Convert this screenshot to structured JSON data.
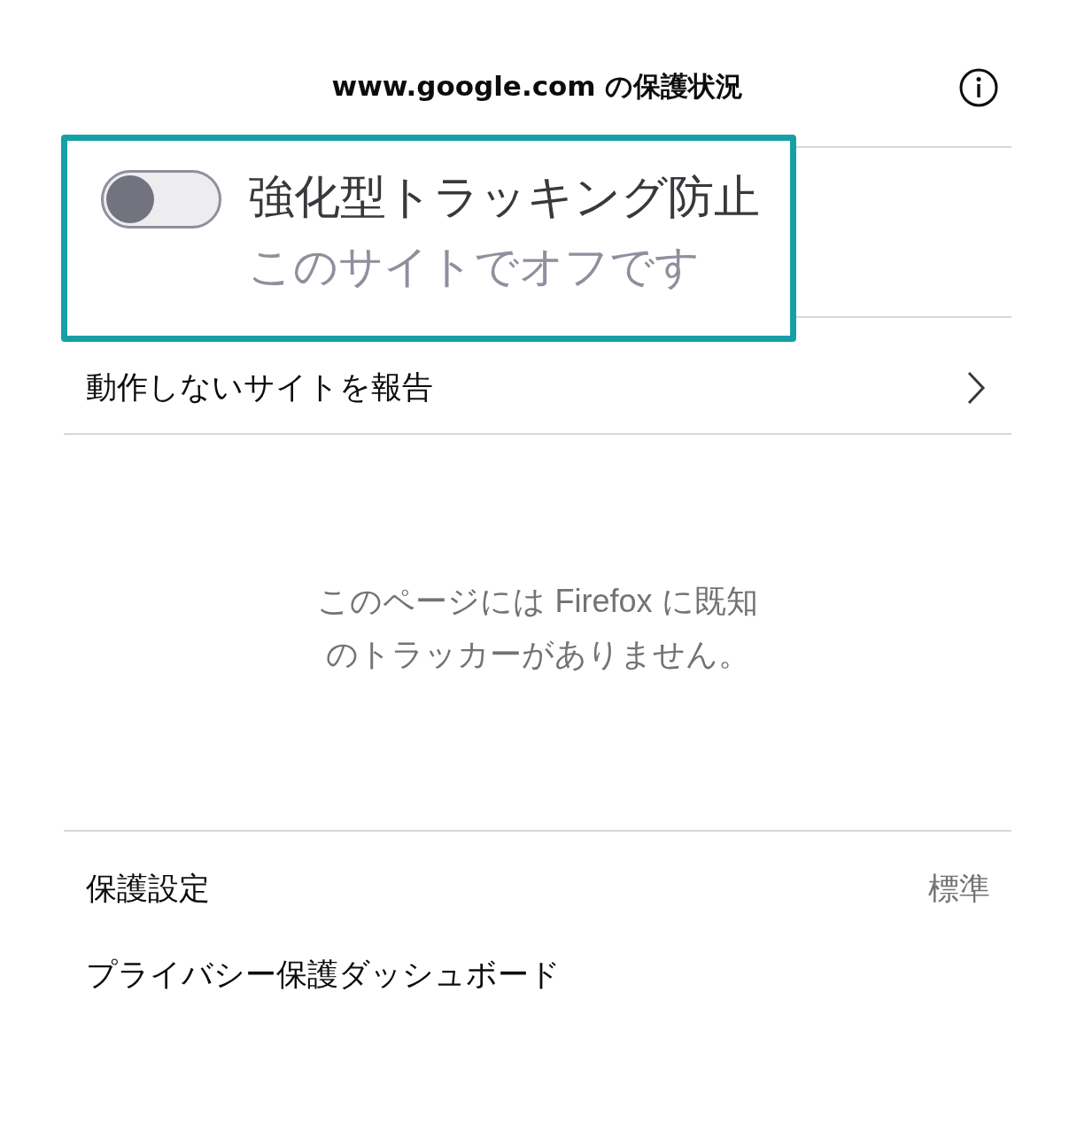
{
  "header": {
    "title": "www.google.com の保護状況"
  },
  "tracking_protection": {
    "label": "強化型トラッキング防止",
    "status": "このサイトでオフです",
    "on": false
  },
  "report_link": {
    "label": "動作しないサイトを報告"
  },
  "message": "このページには Firefox に既知のトラッカーがありません。",
  "settings": {
    "label": "保護設定",
    "value": "標準"
  },
  "dashboard_link": {
    "label": "プライバシー保護ダッシュボード"
  }
}
